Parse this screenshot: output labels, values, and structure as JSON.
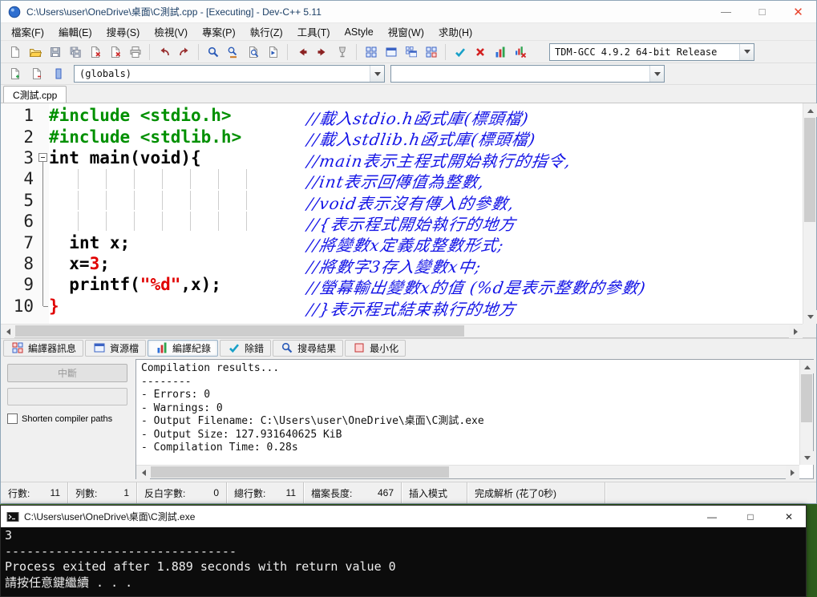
{
  "window": {
    "title": "C:\\Users\\user\\OneDrive\\桌面\\C測試.cpp - [Executing] - Dev-C++ 5.11",
    "controls": {
      "minimize": "—",
      "maximize": "□",
      "close": "✕"
    }
  },
  "menu": [
    "檔案(F)",
    "編輯(E)",
    "搜尋(S)",
    "檢視(V)",
    "專案(P)",
    "執行(Z)",
    "工具(T)",
    "AStyle",
    "視窗(W)",
    "求助(H)"
  ],
  "toolbar": {
    "buttons": [
      {
        "name": "new-file"
      },
      {
        "name": "open"
      },
      {
        "name": "save"
      },
      {
        "name": "save-all"
      },
      {
        "name": "close"
      },
      {
        "name": "close-all"
      },
      {
        "name": "print"
      },
      {
        "sep": true
      },
      {
        "name": "undo"
      },
      {
        "name": "redo"
      },
      {
        "sep": true
      },
      {
        "name": "find"
      },
      {
        "name": "replace"
      },
      {
        "name": "find-in-files"
      },
      {
        "name": "goto-line"
      },
      {
        "sep": true
      },
      {
        "name": "navigate-back"
      },
      {
        "name": "navigate-forward"
      },
      {
        "name": "stop-execution"
      },
      {
        "sep": true
      },
      {
        "name": "compile"
      },
      {
        "name": "run"
      },
      {
        "name": "compile-and-run"
      },
      {
        "name": "rebuild-all"
      },
      {
        "sep": true
      },
      {
        "name": "syntax-check"
      },
      {
        "name": "abort-compilation"
      },
      {
        "name": "profile-analysis"
      },
      {
        "name": "delete-profiling"
      }
    ],
    "compiler_select": "TDM-GCC 4.9.2 64-bit Release"
  },
  "toolbar2": {
    "buttons": [
      {
        "name": "add-to-project"
      },
      {
        "name": "remove-from-project"
      },
      {
        "name": "project-options"
      }
    ],
    "globals_select": "(globals)",
    "members_select": ""
  },
  "tabs": [
    {
      "label": "C測試.cpp",
      "active": true
    }
  ],
  "editor": {
    "lines": [
      {
        "num": "1",
        "code": [
          {
            "t": "#include <stdio.h>",
            "s": "pre"
          }
        ],
        "comment": "//載入stdio.h函式庫(標頭檔)"
      },
      {
        "num": "2",
        "code": [
          {
            "t": "#include <stdlib.h>",
            "s": "pre"
          }
        ],
        "comment": "//載入stdlib.h函式庫(標頭檔)"
      },
      {
        "num": "3",
        "fold": "open",
        "code": [
          {
            "t": "int",
            "s": "kw"
          },
          {
            "t": " main(",
            "s": "pl"
          },
          {
            "t": "void",
            "s": "kw"
          },
          {
            "t": "){",
            "s": "pl"
          }
        ],
        "comment": "//main表示主程式開始執行的指令,"
      },
      {
        "num": "4",
        "fold": "mid",
        "guides": true,
        "code": [],
        "comment": "//int表示回傳值為整數,"
      },
      {
        "num": "5",
        "fold": "mid",
        "guides": true,
        "code": [],
        "comment": "//void表示沒有傳入的參數,"
      },
      {
        "num": "6",
        "fold": "mid",
        "guides": true,
        "code": [],
        "comment": "//{表示程式開始執行的地方"
      },
      {
        "num": "7",
        "fold": "mid",
        "code": [
          {
            "t": "  ",
            "s": "pl"
          },
          {
            "t": "int",
            "s": "kw"
          },
          {
            "t": " x;",
            "s": "pl"
          }
        ],
        "comment": "//將變數x定義成整數形式;"
      },
      {
        "num": "8",
        "fold": "mid",
        "code": [
          {
            "t": "  x=",
            "s": "pl"
          },
          {
            "t": "3",
            "s": "num"
          },
          {
            "t": ";",
            "s": "pl"
          }
        ],
        "comment": "//將數字3存入變數x中;"
      },
      {
        "num": "9",
        "fold": "mid",
        "code": [
          {
            "t": "  printf(",
            "s": "pl"
          },
          {
            "t": "\"%d\"",
            "s": "str"
          },
          {
            "t": ",x);",
            "s": "pl"
          }
        ],
        "comment": "//螢幕輸出變數x的值 (%d是表示整數的參數)"
      },
      {
        "num": "10",
        "fold": "end",
        "code": [
          {
            "t": "}",
            "s": "brace"
          }
        ],
        "comment": "//}表示程式結束執行的地方"
      }
    ]
  },
  "panel": {
    "tabs": [
      {
        "label": "編譯器訊息",
        "icon": "compiler-messages"
      },
      {
        "label": "資源檔",
        "icon": "resource"
      },
      {
        "label": "編譯紀錄",
        "icon": "compile-log",
        "active": true
      },
      {
        "label": "除錯",
        "icon": "debug"
      },
      {
        "label": "搜尋結果",
        "icon": "search-results"
      },
      {
        "label": "最小化",
        "icon": "minimize"
      }
    ],
    "abort_button": "中斷",
    "shorten_label": "Shorten compiler paths",
    "log": [
      "Compilation results...",
      "--------",
      "- Errors: 0",
      "- Warnings: 0",
      "- Output Filename: C:\\Users\\user\\OneDrive\\桌面\\C測試.exe",
      "- Output Size: 127.931640625 KiB",
      "- Compilation Time: 0.28s"
    ]
  },
  "statusbar": [
    {
      "label": "行數:",
      "value": "11"
    },
    {
      "label": "列數:",
      "value": "1"
    },
    {
      "label": "反白字數:",
      "value": "0"
    },
    {
      "label": "總行數:",
      "value": "11"
    },
    {
      "label": "檔案長度:",
      "value": "467"
    },
    {
      "label": "插入模式",
      "value": ""
    },
    {
      "label": "完成解析 (花了0秒)",
      "value": ""
    }
  ],
  "console": {
    "title": "C:\\Users\\user\\OneDrive\\桌面\\C測試.exe",
    "lines": [
      "3",
      "--------------------------------",
      "Process exited after 1.889 seconds with return value 0",
      "請按任意鍵繼續 . . ."
    ]
  }
}
